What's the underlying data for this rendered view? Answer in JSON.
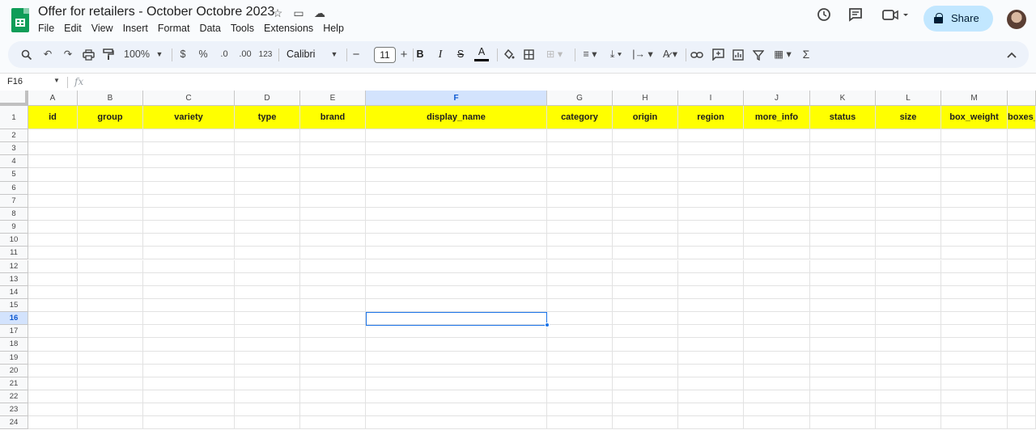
{
  "doc": {
    "title": "Offer for retailers - October Octobre 2023",
    "menus": [
      "File",
      "Edit",
      "View",
      "Insert",
      "Format",
      "Data",
      "Tools",
      "Extensions",
      "Help"
    ],
    "share_label": "Share"
  },
  "toolbar": {
    "zoom": "100%",
    "currency": "$",
    "percent": "%",
    "decrease_decimals": ".0",
    "increase_decimals": ".00",
    "number_format": "123",
    "font": "Calibri",
    "font_size": "11",
    "bold": "B",
    "italic": "I",
    "text_color_letter": "A",
    "function_symbol": "Σ"
  },
  "formula": {
    "name_box": "F16",
    "fx": "fx"
  },
  "sheet": {
    "columns": [
      "A",
      "B",
      "C",
      "D",
      "E",
      "F",
      "G",
      "H",
      "I",
      "J",
      "K",
      "L",
      "M",
      ""
    ],
    "header_row": [
      "id",
      "group",
      "variety",
      "type",
      "brand",
      "display_name",
      "category",
      "origin",
      "region",
      "more_info",
      "status",
      "size",
      "box_weight",
      "boxes_"
    ],
    "row_numbers": [
      "1",
      "2",
      "3",
      "4",
      "5",
      "6",
      "7",
      "8",
      "9",
      "10",
      "11",
      "12",
      "13",
      "14",
      "15",
      "16",
      "17",
      "18",
      "19",
      "20",
      "21",
      "22",
      "23",
      "24"
    ],
    "selected_cell": "F16",
    "header_fill": "#ffff00",
    "accent": "#1a73e8"
  }
}
